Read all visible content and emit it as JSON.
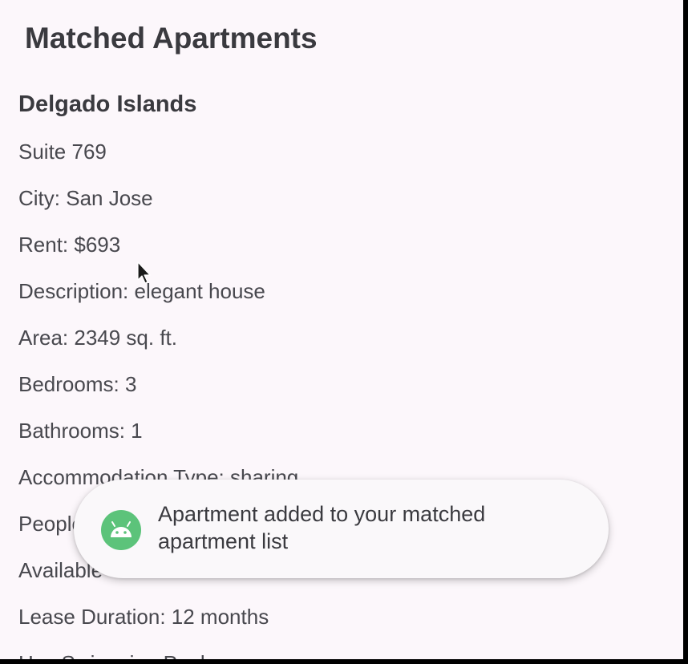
{
  "page": {
    "title": "Matched Apartments"
  },
  "apartment": {
    "name": "Delgado Islands",
    "suite": "Suite 769",
    "city": "City: San Jose",
    "rent": "Rent: $693",
    "description": "Description: elegant house",
    "area": "Area: 2349 sq. ft.",
    "bedrooms": "Bedrooms: 3",
    "bathrooms": "Bathrooms: 1",
    "accommodation": "Accommodation Type: sharing",
    "people": "People",
    "availability": "Available",
    "lease": "Lease Duration: 12 months",
    "next_field": "Has Swimming Pool"
  },
  "toast": {
    "message": "Apartment added to your matched apartment list",
    "icon": "android-icon",
    "icon_color": "#5cc37a"
  },
  "cursor": {
    "icon": "mouse-pointer-icon"
  }
}
